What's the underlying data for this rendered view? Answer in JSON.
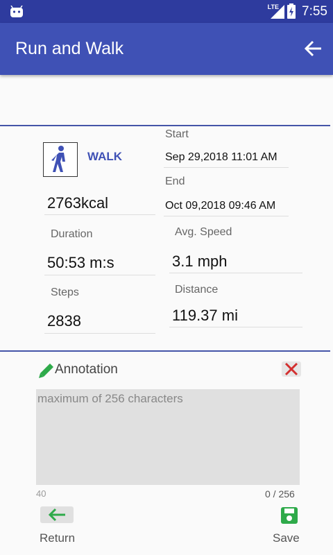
{
  "status": {
    "network": "LTE",
    "time": "7:55"
  },
  "appbar": {
    "title": "Run and Walk"
  },
  "activity": {
    "type": "WALK",
    "calories": "2763kcal"
  },
  "start": {
    "label": "Start",
    "value": "Sep 29,2018 11:01 AM"
  },
  "end": {
    "label": "End",
    "value": "Oct 09,2018 09:46 AM"
  },
  "duration": {
    "label": "Duration",
    "value": "50:53 m:s"
  },
  "speed": {
    "label": "Avg. Speed",
    "value": "3.1 mph"
  },
  "steps": {
    "label": "Steps",
    "value": "2838"
  },
  "distance": {
    "label": "Distance",
    "value": "119.37 mi"
  },
  "annotation": {
    "label": "Annotation",
    "placeholder": "maximum of 256 characters",
    "left_hint": "40",
    "counter": "0 / 256"
  },
  "buttons": {
    "return_label": "Return",
    "save_label": "Save"
  },
  "colors": {
    "primary": "#3f51b5",
    "status": "#2e3b9e",
    "green": "#2eaa4a",
    "red": "#d32f2f"
  }
}
